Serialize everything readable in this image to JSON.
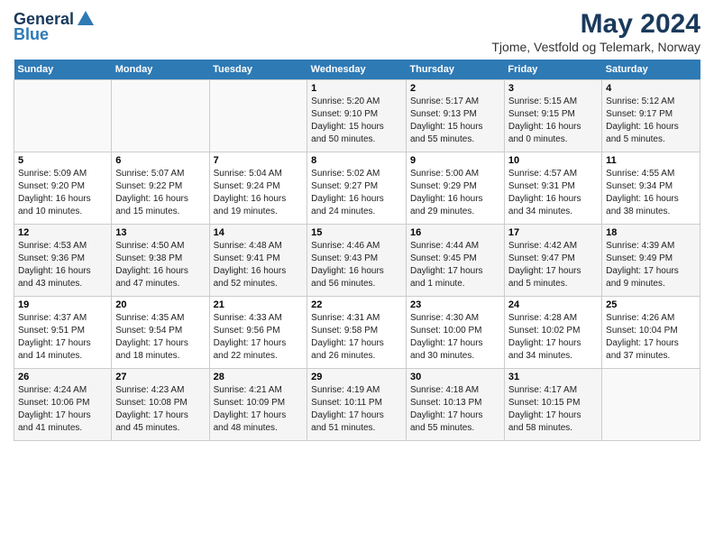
{
  "header": {
    "logo_general": "General",
    "logo_blue": "Blue",
    "month_year": "May 2024",
    "location": "Tjome, Vestfold og Telemark, Norway"
  },
  "days_of_week": [
    "Sunday",
    "Monday",
    "Tuesday",
    "Wednesday",
    "Thursday",
    "Friday",
    "Saturday"
  ],
  "weeks": [
    [
      {
        "day": "",
        "info": ""
      },
      {
        "day": "",
        "info": ""
      },
      {
        "day": "",
        "info": ""
      },
      {
        "day": "1",
        "info": "Sunrise: 5:20 AM\nSunset: 9:10 PM\nDaylight: 15 hours\nand 50 minutes."
      },
      {
        "day": "2",
        "info": "Sunrise: 5:17 AM\nSunset: 9:13 PM\nDaylight: 15 hours\nand 55 minutes."
      },
      {
        "day": "3",
        "info": "Sunrise: 5:15 AM\nSunset: 9:15 PM\nDaylight: 16 hours\nand 0 minutes."
      },
      {
        "day": "4",
        "info": "Sunrise: 5:12 AM\nSunset: 9:17 PM\nDaylight: 16 hours\nand 5 minutes."
      }
    ],
    [
      {
        "day": "5",
        "info": "Sunrise: 5:09 AM\nSunset: 9:20 PM\nDaylight: 16 hours\nand 10 minutes."
      },
      {
        "day": "6",
        "info": "Sunrise: 5:07 AM\nSunset: 9:22 PM\nDaylight: 16 hours\nand 15 minutes."
      },
      {
        "day": "7",
        "info": "Sunrise: 5:04 AM\nSunset: 9:24 PM\nDaylight: 16 hours\nand 19 minutes."
      },
      {
        "day": "8",
        "info": "Sunrise: 5:02 AM\nSunset: 9:27 PM\nDaylight: 16 hours\nand 24 minutes."
      },
      {
        "day": "9",
        "info": "Sunrise: 5:00 AM\nSunset: 9:29 PM\nDaylight: 16 hours\nand 29 minutes."
      },
      {
        "day": "10",
        "info": "Sunrise: 4:57 AM\nSunset: 9:31 PM\nDaylight: 16 hours\nand 34 minutes."
      },
      {
        "day": "11",
        "info": "Sunrise: 4:55 AM\nSunset: 9:34 PM\nDaylight: 16 hours\nand 38 minutes."
      }
    ],
    [
      {
        "day": "12",
        "info": "Sunrise: 4:53 AM\nSunset: 9:36 PM\nDaylight: 16 hours\nand 43 minutes."
      },
      {
        "day": "13",
        "info": "Sunrise: 4:50 AM\nSunset: 9:38 PM\nDaylight: 16 hours\nand 47 minutes."
      },
      {
        "day": "14",
        "info": "Sunrise: 4:48 AM\nSunset: 9:41 PM\nDaylight: 16 hours\nand 52 minutes."
      },
      {
        "day": "15",
        "info": "Sunrise: 4:46 AM\nSunset: 9:43 PM\nDaylight: 16 hours\nand 56 minutes."
      },
      {
        "day": "16",
        "info": "Sunrise: 4:44 AM\nSunset: 9:45 PM\nDaylight: 17 hours\nand 1 minute."
      },
      {
        "day": "17",
        "info": "Sunrise: 4:42 AM\nSunset: 9:47 PM\nDaylight: 17 hours\nand 5 minutes."
      },
      {
        "day": "18",
        "info": "Sunrise: 4:39 AM\nSunset: 9:49 PM\nDaylight: 17 hours\nand 9 minutes."
      }
    ],
    [
      {
        "day": "19",
        "info": "Sunrise: 4:37 AM\nSunset: 9:51 PM\nDaylight: 17 hours\nand 14 minutes."
      },
      {
        "day": "20",
        "info": "Sunrise: 4:35 AM\nSunset: 9:54 PM\nDaylight: 17 hours\nand 18 minutes."
      },
      {
        "day": "21",
        "info": "Sunrise: 4:33 AM\nSunset: 9:56 PM\nDaylight: 17 hours\nand 22 minutes."
      },
      {
        "day": "22",
        "info": "Sunrise: 4:31 AM\nSunset: 9:58 PM\nDaylight: 17 hours\nand 26 minutes."
      },
      {
        "day": "23",
        "info": "Sunrise: 4:30 AM\nSunset: 10:00 PM\nDaylight: 17 hours\nand 30 minutes."
      },
      {
        "day": "24",
        "info": "Sunrise: 4:28 AM\nSunset: 10:02 PM\nDaylight: 17 hours\nand 34 minutes."
      },
      {
        "day": "25",
        "info": "Sunrise: 4:26 AM\nSunset: 10:04 PM\nDaylight: 17 hours\nand 37 minutes."
      }
    ],
    [
      {
        "day": "26",
        "info": "Sunrise: 4:24 AM\nSunset: 10:06 PM\nDaylight: 17 hours\nand 41 minutes."
      },
      {
        "day": "27",
        "info": "Sunrise: 4:23 AM\nSunset: 10:08 PM\nDaylight: 17 hours\nand 45 minutes."
      },
      {
        "day": "28",
        "info": "Sunrise: 4:21 AM\nSunset: 10:09 PM\nDaylight: 17 hours\nand 48 minutes."
      },
      {
        "day": "29",
        "info": "Sunrise: 4:19 AM\nSunset: 10:11 PM\nDaylight: 17 hours\nand 51 minutes."
      },
      {
        "day": "30",
        "info": "Sunrise: 4:18 AM\nSunset: 10:13 PM\nDaylight: 17 hours\nand 55 minutes."
      },
      {
        "day": "31",
        "info": "Sunrise: 4:17 AM\nSunset: 10:15 PM\nDaylight: 17 hours\nand 58 minutes."
      },
      {
        "day": "",
        "info": ""
      }
    ]
  ]
}
